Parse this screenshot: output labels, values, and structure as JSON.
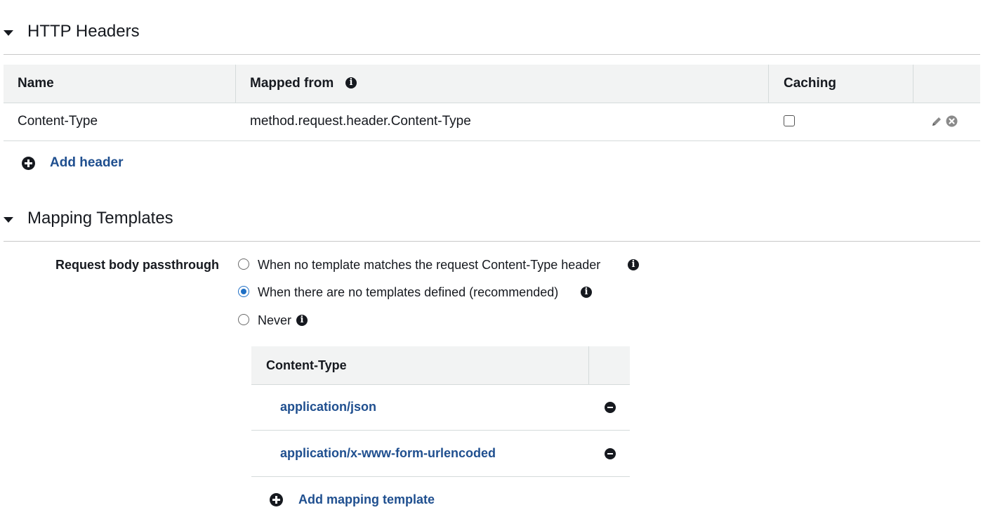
{
  "http_headers": {
    "title": "HTTP Headers",
    "columns": {
      "name": "Name",
      "mapped_from": "Mapped from",
      "caching": "Caching"
    },
    "rows": [
      {
        "name": "Content-Type",
        "mapped_from": "method.request.header.Content-Type",
        "caching": false
      }
    ],
    "add_label": "Add header"
  },
  "mapping_templates": {
    "title": "Mapping Templates",
    "passthrough_label": "Request body passthrough",
    "options": [
      {
        "label": "When no template matches the request Content-Type header",
        "selected": false
      },
      {
        "label": "When there are no templates defined (recommended)",
        "selected": true
      },
      {
        "label": "Never",
        "selected": false
      }
    ],
    "table_header": "Content-Type",
    "content_types": [
      "application/json",
      "application/x-www-form-urlencoded"
    ],
    "add_label": "Add mapping template"
  },
  "icons": {
    "caret": "triangle-down",
    "info": "info-circle",
    "add": "plus-circle",
    "remove": "minus-circle",
    "edit": "pencil",
    "delete": "x-circle"
  },
  "colors": {
    "link": "#1f4f8f",
    "radio_selected": "#1f6fc5",
    "table_header_bg": "#f2f3f3"
  }
}
